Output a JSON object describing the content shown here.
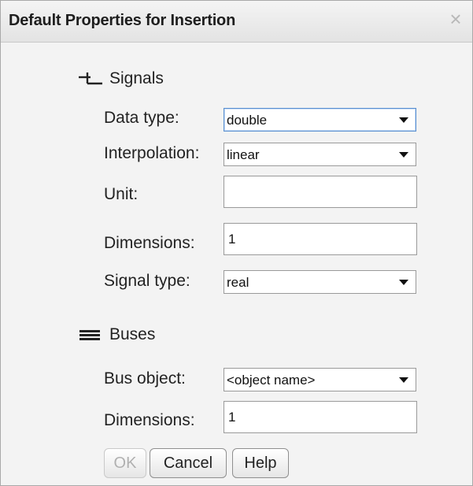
{
  "dialog": {
    "title": "Default Properties for Insertion",
    "close_symbol": "×"
  },
  "signals": {
    "heading": "Signals",
    "icon": "signal-line-icon",
    "data_type_label": "Data type:",
    "data_type_value": "double",
    "interpolation_label": "Interpolation:",
    "interpolation_value": "linear",
    "unit_label": "Unit:",
    "unit_value": "",
    "dimensions_label": "Dimensions:",
    "dimensions_value": "1",
    "signal_type_label": "Signal type:",
    "signal_type_value": "real"
  },
  "buses": {
    "heading": "Buses",
    "icon": "bus-lines-icon",
    "bus_object_label": "Bus object:",
    "bus_object_value": "<object name>",
    "dimensions_label": "Dimensions:",
    "dimensions_value": "1"
  },
  "buttons": {
    "ok": "OK",
    "cancel": "Cancel",
    "help": "Help"
  }
}
